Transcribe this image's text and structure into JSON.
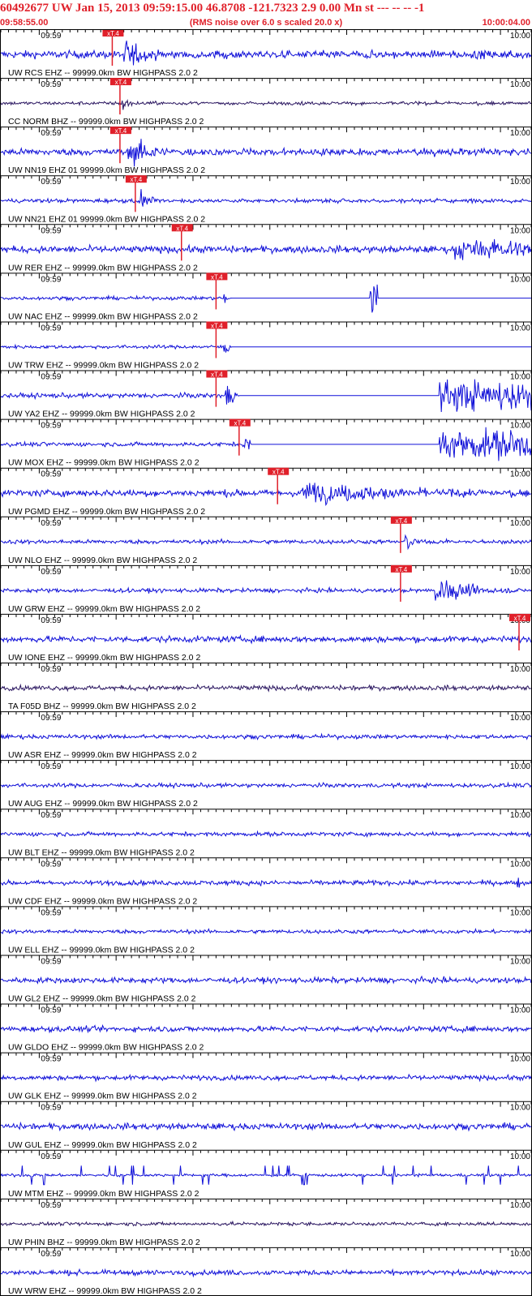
{
  "header": {
    "title": "60492677 UW Jan 15, 2013 09:59:15.00   46.8708 -121.7323  2.9 0.00 Mn st --- -- --  -1",
    "start_time": "09:58:55.00",
    "scale_note": "(RMS noise over 6.0 s scaled 20.0 x)",
    "end_time": "10:00:04.00"
  },
  "colors": {
    "title": "#e0202a",
    "trace": "#1010d8",
    "trace_dark": "#2a1660",
    "pick": "#e0202a",
    "baseline": "#000000",
    "text": "#000000"
  },
  "chart_data": {
    "type": "line",
    "title": "60492677 UW Jan 15, 2013 09:59:15.00   46.8708 -121.7323  2.9 0.00 Mn st --- -- --  -1",
    "x_range": [
      "09:58:55.00",
      "10:00:04.00"
    ],
    "tick_labels": [
      "09:59",
      "10:00"
    ],
    "pick_label": "xT.4",
    "grid": false,
    "series": [
      {
        "name": "UW RCS EHZ -- 99999.0km BW  HIGHPASS  2.0  2",
        "pick_time_s": 14.5,
        "noise": 0.55,
        "burst_time_s": 16,
        "burst_amp": 2.6,
        "burst_decay_s": 2.5,
        "dark": false,
        "pick_label": "xT.4"
      },
      {
        "name": "CC NORM BHZ -- 99999.0km BW  HIGHPASS  2.0  2",
        "pick_time_s": 15.5,
        "noise": 0.25,
        "burst_time_s": 15.8,
        "burst_amp": 2.0,
        "burst_decay_s": 0.6,
        "dark": true,
        "pick_label": "xT.4"
      },
      {
        "name": "UW NN19 EHZ 01 99999.0km BW  HIGHPASS  2.0  2",
        "pick_time_s": 15.5,
        "noise": 0.5,
        "burst_time_s": 16.5,
        "burst_amp": 2.4,
        "burst_decay_s": 3.0,
        "dark": false,
        "pick_label": "xT.4"
      },
      {
        "name": "UW NN21 EHZ 01 99999.0km BW  HIGHPASS  2.0  2",
        "pick_time_s": 17.5,
        "noise": 0.3,
        "burst_time_s": 18.0,
        "burst_amp": 2.0,
        "burst_decay_s": 1.2,
        "dark": false,
        "pick_label": "xT.4"
      },
      {
        "name": "UW RER EHZ -- 99999.0km BW  HIGHPASS  2.0  2",
        "pick_time_s": 23.5,
        "noise": 0.5,
        "burst_time_s": 59,
        "burst_amp": 1.4,
        "burst_decay_s": 40,
        "dark": false,
        "pick_label": "xT.4"
      },
      {
        "name": "UW NAC EHZ -- 99999.0km BW  HIGHPASS  2.0  2",
        "pick_time_s": 28.0,
        "noise": 0.25,
        "burst_time_s": 29.0,
        "burst_amp": 2.5,
        "burst_decay_s": 0.5,
        "dark": false,
        "flat_from_s": 30.0,
        "pick_label": "xT.4"
      },
      {
        "name": "UW TRW EHZ -- 99999.0km BW  HIGHPASS  2.0  2",
        "pick_time_s": 28.0,
        "noise": 0.25,
        "burst_time_s": 29.0,
        "burst_amp": 2.0,
        "burst_decay_s": 0.6,
        "dark": false,
        "flat_from_s": 30.0,
        "pick_label": "xT.4"
      },
      {
        "name": "UW YA2 EHZ -- 99999.0km BW  HIGHPASS  2.0  2",
        "pick_time_s": 28.0,
        "noise": 0.35,
        "burst_time_s": 29.2,
        "burst_amp": 3.0,
        "burst_decay_s": 0.8,
        "dark": false,
        "flat_from_s": 31.0,
        "pick_label": "xT.4"
      },
      {
        "name": "UW MOX EHZ -- 99999.0km BW  HIGHPASS  2.0  2",
        "pick_time_s": 31.0,
        "noise": 0.3,
        "burst_time_s": 31.5,
        "burst_amp": 2.5,
        "burst_decay_s": 0.7,
        "dark": false,
        "flat_from_s": 32.5,
        "pick_label": "xT.4"
      },
      {
        "name": "UW PGMD EHZ -- 99999.0km BW  HIGHPASS  2.0  2",
        "pick_time_s": 36.0,
        "noise": 0.5,
        "burst_time_s": 39.0,
        "burst_amp": 1.7,
        "burst_decay_s": 14,
        "dark": false,
        "pick_label": "xT.4"
      },
      {
        "name": "UW NLO EHZ -- 99999.0km BW  HIGHPASS  2.0  2",
        "pick_time_s": 52.0,
        "noise": 0.3,
        "burst_time_s": 52.5,
        "burst_amp": 2.2,
        "burst_decay_s": 0.8,
        "dark": false,
        "pick_label": "xT.4"
      },
      {
        "name": "UW GRW EHZ -- 99999.0km BW  HIGHPASS  2.0  2",
        "pick_time_s": 52.0,
        "noise": 0.3,
        "burst_time_s": 56.5,
        "burst_amp": 2.6,
        "burst_decay_s": 3.5,
        "dark": false,
        "pick_label": "xT.4"
      },
      {
        "name": "UW IONE EHZ -- 99999.0km BW  HIGHPASS  2.0  2",
        "pick_time_s": 107.5,
        "noise": 0.45,
        "dark": false,
        "pick_label": "xT.4"
      },
      {
        "name": "TA F05D BHZ -- 99999.0km BW  HIGHPASS  2.0  2",
        "noise": 0.35,
        "dark": true
      },
      {
        "name": "UW ASR EHZ -- 99999.0km BW  HIGHPASS  2.0  2",
        "noise": 0.3,
        "dark": false
      },
      {
        "name": "UW AUG EHZ -- 99999.0km BW  HIGHPASS  2.0  2",
        "noise": 0.3,
        "dark": false
      },
      {
        "name": "UW BLT EHZ -- 99999.0km BW  HIGHPASS  2.0  2",
        "noise": 0.3,
        "dark": false
      },
      {
        "name": "UW CDF EHZ -- 99999.0km BW  HIGHPASS  2.0  2",
        "noise": 0.35,
        "burst_time_s": 67.0,
        "burst_amp": 1.4,
        "burst_decay_s": 0.4,
        "dark": false
      },
      {
        "name": "UW ELL EHZ -- 99999.0km BW  HIGHPASS  2.0  2",
        "noise": 0.28,
        "dark": false
      },
      {
        "name": "UW GL2 EHZ -- 99999.0km BW  HIGHPASS  2.0  2",
        "noise": 0.4,
        "dark": false
      },
      {
        "name": "UW GLDO EHZ -- 99999.0km BW  HIGHPASS  2.0  2",
        "noise": 0.4,
        "dark": false
      },
      {
        "name": "UW GLK EHZ -- 99999.0km BW  HIGHPASS  2.0  2",
        "noise": 0.35,
        "dark": false
      },
      {
        "name": "UW GUL EHZ -- 99999.0km BW  HIGHPASS  2.0  2",
        "noise": 0.45,
        "burst_time_s": 76,
        "burst_amp": 1.2,
        "burst_decay_s": 8,
        "dark": false
      },
      {
        "name": "UW MTM EHZ -- 99999.0km BW  HIGHPASS  2.0  2",
        "noise": 0.2,
        "spiky": true,
        "dark": false
      },
      {
        "name": "UW PHIN BHZ -- 99999.0km BW  HIGHPASS  2.0  2",
        "noise": 0.25,
        "dark": true
      },
      {
        "name": "UW WRW EHZ -- 99999.0km BW  HIGHPASS  2.0  2",
        "noise": 0.35,
        "dark": false
      }
    ]
  }
}
